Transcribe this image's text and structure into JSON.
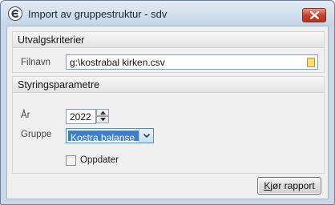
{
  "window": {
    "title": "Import av gruppestruktur - sdv"
  },
  "criteria": {
    "header": "Utvalgskriterier",
    "file_label": "Filnavn",
    "file_value": "g:\\kostrabal kirken.csv"
  },
  "params": {
    "header": "Styringsparametre",
    "year_label": "År",
    "year_value": "2022",
    "group_label": "Gruppe",
    "group_value": "Kostra balanse",
    "update_label": "Oppdater",
    "update_checked": false
  },
  "actions": {
    "run_label_first": "K",
    "run_label_rest": "jør rapport"
  },
  "colors": {
    "title_bar": "#c5d4e6",
    "close_button": "#c7432d",
    "selection": "#3b7fd3"
  },
  "icons": [
    "app-icon",
    "close-icon",
    "folder-icon",
    "spin-up-icon",
    "spin-down-icon",
    "chevron-down-icon"
  ]
}
